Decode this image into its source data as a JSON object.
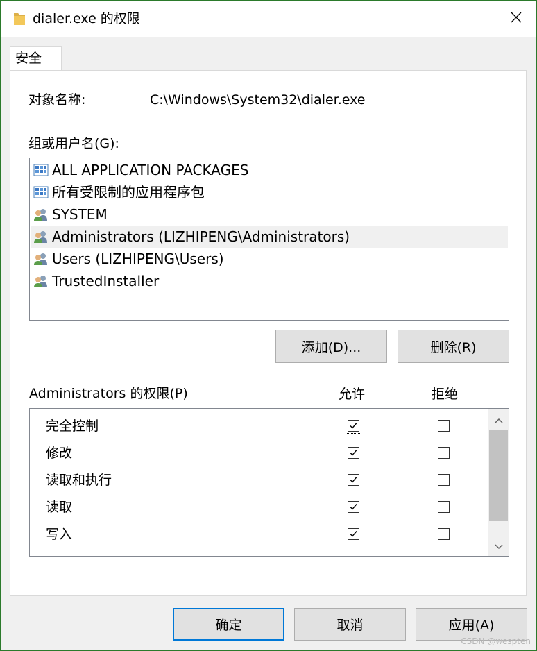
{
  "window": {
    "title": "dialer.exe 的权限",
    "icon": "folder-icon"
  },
  "tabs": [
    {
      "label": "安全"
    }
  ],
  "object": {
    "label": "对象名称:",
    "value": "C:\\Windows\\System32\\dialer.exe"
  },
  "groups": {
    "label": "组或用户名(G):",
    "items": [
      {
        "label": "ALL APPLICATION PACKAGES",
        "icon": "package-group-icon",
        "selected": false
      },
      {
        "label": "所有受限制的应用程序包",
        "icon": "package-group-icon",
        "selected": false
      },
      {
        "label": "SYSTEM",
        "icon": "user-group-icon",
        "selected": false
      },
      {
        "label": "Administrators (LIZHIPENG\\Administrators)",
        "icon": "user-group-icon",
        "selected": true
      },
      {
        "label": "Users (LIZHIPENG\\Users)",
        "icon": "user-group-icon",
        "selected": false
      },
      {
        "label": "TrustedInstaller",
        "icon": "user-group-icon",
        "selected": false
      }
    ]
  },
  "buttons": {
    "add": "添加(D)...",
    "remove": "删除(R)",
    "ok": "确定",
    "cancel": "取消",
    "apply": "应用(A)"
  },
  "permissions": {
    "label": "Administrators 的权限(P)",
    "allow_header": "允许",
    "deny_header": "拒绝",
    "rows": [
      {
        "name": "完全控制",
        "allow": true,
        "deny": false
      },
      {
        "name": "修改",
        "allow": true,
        "deny": false
      },
      {
        "name": "读取和执行",
        "allow": true,
        "deny": false
      },
      {
        "name": "读取",
        "allow": true,
        "deny": false
      },
      {
        "name": "写入",
        "allow": true,
        "deny": false
      }
    ]
  },
  "watermark": "CSDN @wespten",
  "colors": {
    "focus_blue": "#0078d7",
    "selected_row": "#f0f0f0",
    "window_border": "#2b7a2b"
  }
}
